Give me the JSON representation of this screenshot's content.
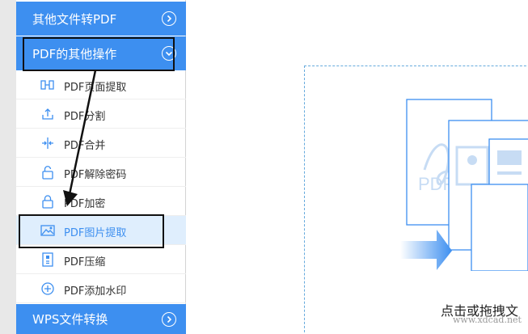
{
  "sidebar": {
    "section_top": "其他文件转PDF",
    "section_pdf_ops": "PDF的其他操作",
    "items": [
      {
        "label": "PDF页面提取",
        "icon": "page-extract-icon"
      },
      {
        "label": "PDF分割",
        "icon": "upload-split-icon"
      },
      {
        "label": "PDF合并",
        "icon": "merge-icon"
      },
      {
        "label": "PDF解除密码",
        "icon": "unlock-icon"
      },
      {
        "label": "PDF加密",
        "icon": "lock-icon"
      },
      {
        "label": "PDF图片提取",
        "icon": "image-icon"
      },
      {
        "label": "PDF压缩",
        "icon": "compress-icon"
      },
      {
        "label": "PDF添加水印",
        "icon": "add-circle-icon"
      }
    ],
    "section_bottom": "WPS文件转换"
  },
  "main": {
    "drop_hint": "点击或拖拽文",
    "illustration_doc_label": "PDF"
  },
  "watermark": "www.xdcad.net",
  "colors": {
    "accent": "#3d8ff0",
    "active_bg": "#dfeefd",
    "illustration": "#3d8ff0"
  }
}
